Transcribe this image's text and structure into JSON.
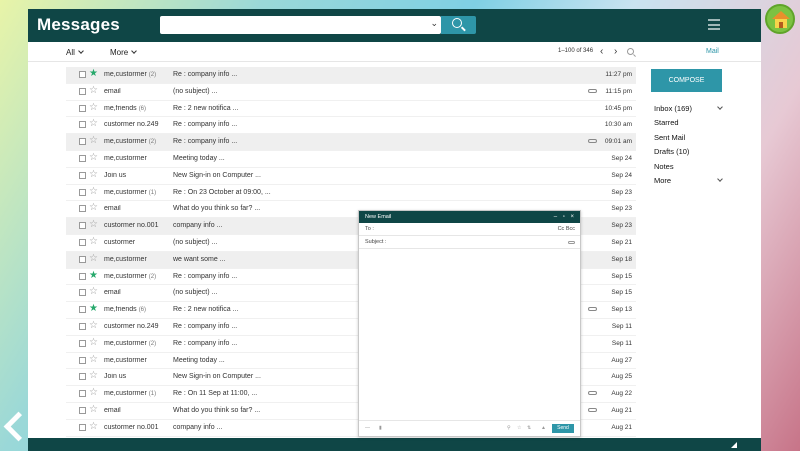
{
  "app": {
    "title": "Messages"
  },
  "search": {
    "placeholder": ""
  },
  "toolbar": {
    "all_label": "All",
    "more_label": "More",
    "range_label": "1–100 of 346",
    "mail_label": "Mail"
  },
  "compose": {
    "label": "COMPOSE"
  },
  "folders": [
    {
      "label": "Inbox  (169)",
      "dropdown": true
    },
    {
      "label": "Starred",
      "dropdown": false
    },
    {
      "label": "Sent Mail",
      "dropdown": false
    },
    {
      "label": "Drafts (10)",
      "dropdown": false
    },
    {
      "label": "Notes",
      "dropdown": false
    },
    {
      "label": "More",
      "dropdown": true
    }
  ],
  "messages": [
    {
      "from": "me,custormer",
      "count": "(2)",
      "subject": "Re : company info ...",
      "time": "11:27 pm",
      "starred": true,
      "shaded": true,
      "attachment": false
    },
    {
      "from": "email",
      "count": "",
      "subject": "(no subject) ...",
      "time": "11:15 pm",
      "starred": false,
      "shaded": false,
      "attachment": true
    },
    {
      "from": "me,friends",
      "count": "(6)",
      "subject": "Re : 2 new notifica ...",
      "time": "10:45 pm",
      "starred": false,
      "shaded": false,
      "attachment": false
    },
    {
      "from": "custormer no.249",
      "count": "",
      "subject": "Re : company info ...",
      "time": "10:30 am",
      "starred": false,
      "shaded": false,
      "attachment": false
    },
    {
      "from": "me,custormer",
      "count": "(2)",
      "subject": "Re : company info ...",
      "time": "09:01 am",
      "starred": false,
      "shaded": true,
      "attachment": true
    },
    {
      "from": "me,custormer",
      "count": "",
      "subject": "Meeting today ...",
      "time": "Sep 24",
      "starred": false,
      "shaded": false,
      "attachment": false
    },
    {
      "from": "Join us",
      "count": "",
      "subject": "New Sign-in on Computer ...",
      "time": "Sep 24",
      "starred": false,
      "shaded": false,
      "attachment": false
    },
    {
      "from": "me,custormer",
      "count": "(1)",
      "subject": "Re : On 23 October at 09:00, ...",
      "time": "Sep 23",
      "starred": false,
      "shaded": false,
      "attachment": false
    },
    {
      "from": "email",
      "count": "",
      "subject": "What do you think so far? ...",
      "time": "Sep 23",
      "starred": false,
      "shaded": false,
      "attachment": false
    },
    {
      "from": "custormer no.001",
      "count": "",
      "subject": "company info ...",
      "time": "Sep 23",
      "starred": false,
      "shaded": true,
      "attachment": false
    },
    {
      "from": "custormer",
      "count": "",
      "subject": "(no subject) ...",
      "time": "Sep 21",
      "starred": false,
      "shaded": false,
      "attachment": false
    },
    {
      "from": "me,custormer",
      "count": "",
      "subject": "we want some ...",
      "time": "Sep 18",
      "starred": false,
      "shaded": true,
      "attachment": false
    },
    {
      "from": "me,custormer",
      "count": "(2)",
      "subject": "Re : company info ...",
      "time": "Sep 15",
      "starred": true,
      "shaded": false,
      "attachment": false
    },
    {
      "from": "email",
      "count": "",
      "subject": "(no subject) ...",
      "time": "Sep 15",
      "starred": false,
      "shaded": false,
      "attachment": false
    },
    {
      "from": "me,friends",
      "count": "(6)",
      "subject": "Re : 2 new notifica ...",
      "time": "Sep 13",
      "starred": true,
      "shaded": false,
      "attachment": true
    },
    {
      "from": "custormer no.249",
      "count": "",
      "subject": "Re : company info ...",
      "time": "Sep 11",
      "starred": false,
      "shaded": false,
      "attachment": false
    },
    {
      "from": "me,custormer",
      "count": "(2)",
      "subject": "Re : company info ...",
      "time": "Sep 11",
      "starred": false,
      "shaded": false,
      "attachment": false
    },
    {
      "from": "me,custormer",
      "count": "",
      "subject": "Meeting today ...",
      "time": "Aug 27",
      "starred": false,
      "shaded": false,
      "attachment": false
    },
    {
      "from": "Join us",
      "count": "",
      "subject": "New Sign-in on Computer ...",
      "time": "Aug 25",
      "starred": false,
      "shaded": false,
      "attachment": false
    },
    {
      "from": "me,custormer",
      "count": "(1)",
      "subject": "Re : On 11 Sep at 11:00, ...",
      "time": "Aug 22",
      "starred": false,
      "shaded": false,
      "attachment": true
    },
    {
      "from": "email",
      "count": "",
      "subject": "What do you think so far? ...",
      "time": "Aug 21",
      "starred": false,
      "shaded": false,
      "attachment": true
    },
    {
      "from": "custormer no.001",
      "count": "",
      "subject": "company info ...",
      "time": "Aug 21",
      "starred": false,
      "shaded": false,
      "attachment": false
    }
  ],
  "new_email": {
    "title": "New Email",
    "controls": "– ▫ ×",
    "to_label": "To :",
    "cc_bcc_label": "Cc  Bcc",
    "subject_label": "Subject :",
    "send_label": "Send"
  },
  "icons": {
    "home": "home-icon",
    "back": "back-arrow-icon",
    "menu": "hamburger-icon",
    "search": "search-icon"
  },
  "colors": {
    "header_bg": "#0f4646",
    "accent": "#2e96a8",
    "star_active": "#27a96c"
  }
}
